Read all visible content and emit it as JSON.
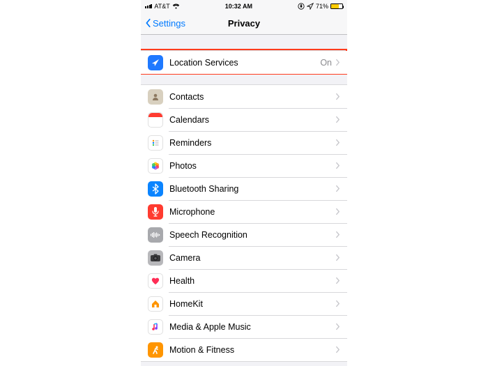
{
  "status": {
    "carrier": "AT&T",
    "time": "10:32 AM",
    "battery_pct": "71%",
    "battery_level": 71
  },
  "nav": {
    "back_label": "Settings",
    "title": "Privacy"
  },
  "highlighted_index": 0,
  "rows": [
    {
      "label": "Location Services",
      "value": "On",
      "icon": "location"
    },
    {
      "label": "Contacts",
      "icon": "contacts"
    },
    {
      "label": "Calendars",
      "icon": "calendars"
    },
    {
      "label": "Reminders",
      "icon": "reminders"
    },
    {
      "label": "Photos",
      "icon": "photos"
    },
    {
      "label": "Bluetooth Sharing",
      "icon": "bluetooth"
    },
    {
      "label": "Microphone",
      "icon": "mic"
    },
    {
      "label": "Speech Recognition",
      "icon": "speech"
    },
    {
      "label": "Camera",
      "icon": "camera"
    },
    {
      "label": "Health",
      "icon": "health"
    },
    {
      "label": "HomeKit",
      "icon": "homekit"
    },
    {
      "label": "Media & Apple Music",
      "icon": "media"
    },
    {
      "label": "Motion & Fitness",
      "icon": "motion"
    }
  ]
}
